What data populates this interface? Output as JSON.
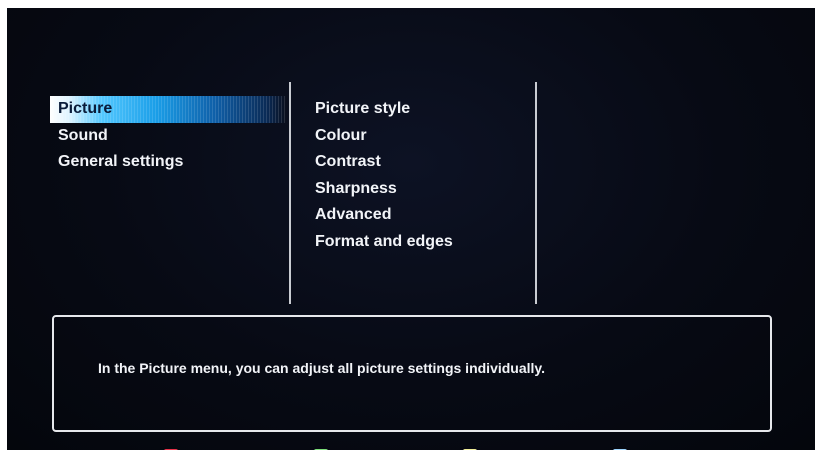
{
  "main_menu": {
    "items": [
      {
        "label": "Picture",
        "selected": true
      },
      {
        "label": "Sound",
        "selected": false
      },
      {
        "label": "General settings",
        "selected": false
      }
    ]
  },
  "sub_menu": {
    "items": [
      {
        "label": "Picture style"
      },
      {
        "label": "Colour"
      },
      {
        "label": "Contrast"
      },
      {
        "label": "Sharpness"
      },
      {
        "label": "Advanced"
      },
      {
        "label": "Format and edges"
      }
    ]
  },
  "info_box": {
    "text": "In the Picture menu, you can adjust all picture settings individually."
  },
  "color_keys": [
    {
      "name": "red",
      "color": "#e8334a"
    },
    {
      "name": "green",
      "color": "#7ee07a"
    },
    {
      "name": "yellow",
      "color": "#f2ef9a"
    },
    {
      "name": "blue",
      "color": "#9fd6ff"
    }
  ],
  "colors": {
    "background": "#070a14",
    "text": "#f2f4f8",
    "highlight": "#1a9ee8",
    "divider": "#c9ccd2"
  }
}
